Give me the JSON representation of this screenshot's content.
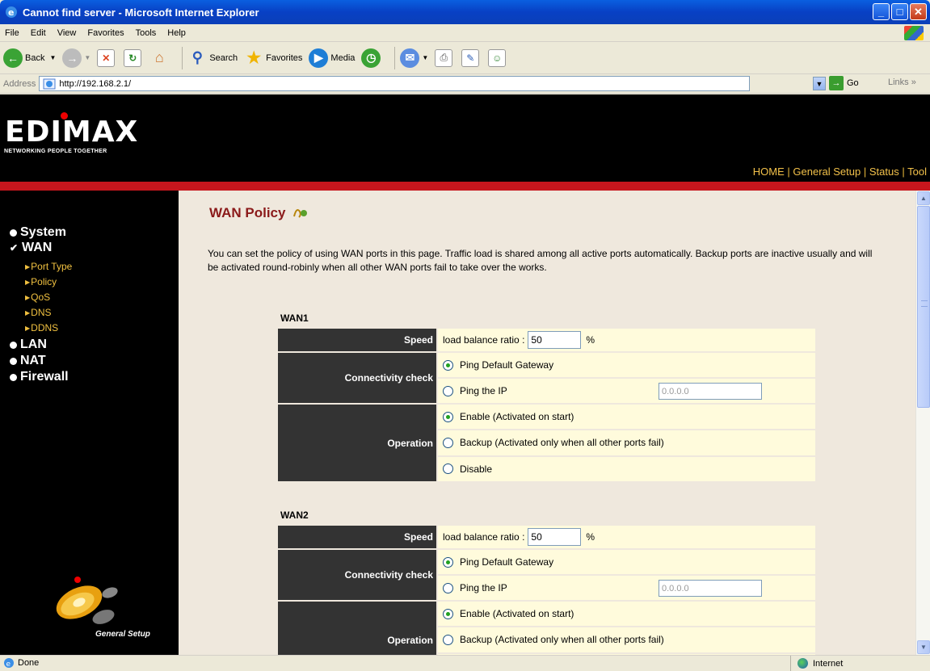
{
  "window": {
    "title": "Cannot find server - Microsoft Internet Explorer"
  },
  "menu": [
    "File",
    "Edit",
    "View",
    "Favorites",
    "Tools",
    "Help"
  ],
  "toolbar": {
    "back": "Back",
    "search": "Search",
    "favorites": "Favorites",
    "media": "Media"
  },
  "address": {
    "label": "Address",
    "url": "http://192.168.2.1/",
    "go": "Go",
    "links": "Links"
  },
  "brand": {
    "logo": "EDIMAX",
    "tagline": "NETWORKING PEOPLE TOGETHER"
  },
  "topnav": {
    "home": "HOME",
    "general_setup": "General Setup",
    "status": "Status",
    "tool": "Tool",
    "sep": "|"
  },
  "sidebar": {
    "items": {
      "system": "System",
      "wan": "WAN",
      "lan": "LAN",
      "nat": "NAT",
      "firewall": "Firewall"
    },
    "wan_sub": {
      "port_type": "Port Type",
      "policy": "Policy",
      "qos": "QoS",
      "dns": "DNS",
      "ddns": "DDNS"
    },
    "footer_label": "General Setup"
  },
  "page": {
    "title": "WAN Policy",
    "description": "You can set the policy of using WAN ports in this page. Traffic load is shared among all active ports automatically. Backup ports are inactive usually and will be activated round-robinly when all other WAN ports fail to take over the works."
  },
  "labels": {
    "speed": "Speed",
    "connectivity": "Connectivity check",
    "operation": "Operation",
    "load_balance": "load balance ratio :",
    "percent": "%",
    "ping_gateway": "Ping Default Gateway",
    "ping_ip": "Ping the IP",
    "enable": "Enable (Activated on start)",
    "backup": "Backup (Activated only when all other ports fail)",
    "disable": "Disable"
  },
  "wan1": {
    "name": "WAN1",
    "ratio": "50",
    "ip": "0.0.0.0"
  },
  "wan2": {
    "name": "WAN2",
    "ratio": "50",
    "ip": "0.0.0.0"
  },
  "status": {
    "left": "Done",
    "zone": "Internet"
  }
}
